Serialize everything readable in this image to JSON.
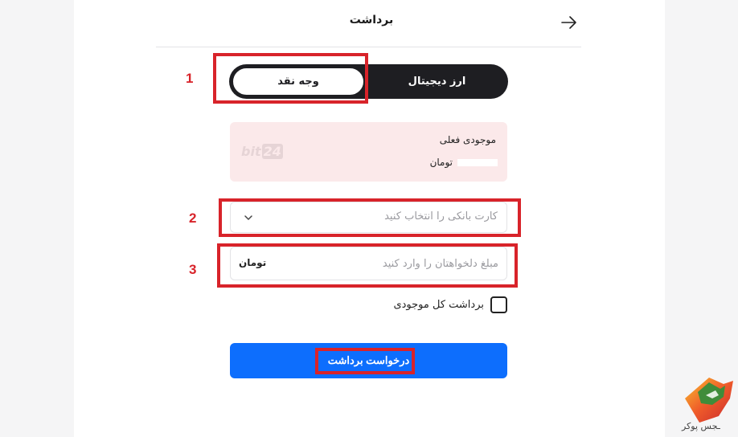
{
  "header": {
    "title": "برداشت"
  },
  "tabs": {
    "crypto_label": "ارز دیجیتال",
    "cash_label": "وجه نقد",
    "active": "cash"
  },
  "balance": {
    "label": "موجودی فعلی",
    "currency": "تومان",
    "logo_text": "bit",
    "logo_num": "24"
  },
  "bank_card": {
    "placeholder": "کارت بانکی را انتخاب کنید"
  },
  "amount": {
    "placeholder": "مبلغ دلخواهتان را وارد کنید",
    "unit": "تومان"
  },
  "withdraw_all": {
    "label": "برداشت کل موجودی",
    "checked": false
  },
  "submit": {
    "label": "درخواست برداشت"
  },
  "annotations": {
    "n1": "1",
    "n2": "2",
    "n3": "3",
    "color": "#d8232a"
  },
  "watermark": {
    "text": "ـجس پوکر"
  },
  "colors": {
    "primary": "#0d6efd",
    "dark": "#1e1e22",
    "balance_bg": "#fbe9ea"
  }
}
